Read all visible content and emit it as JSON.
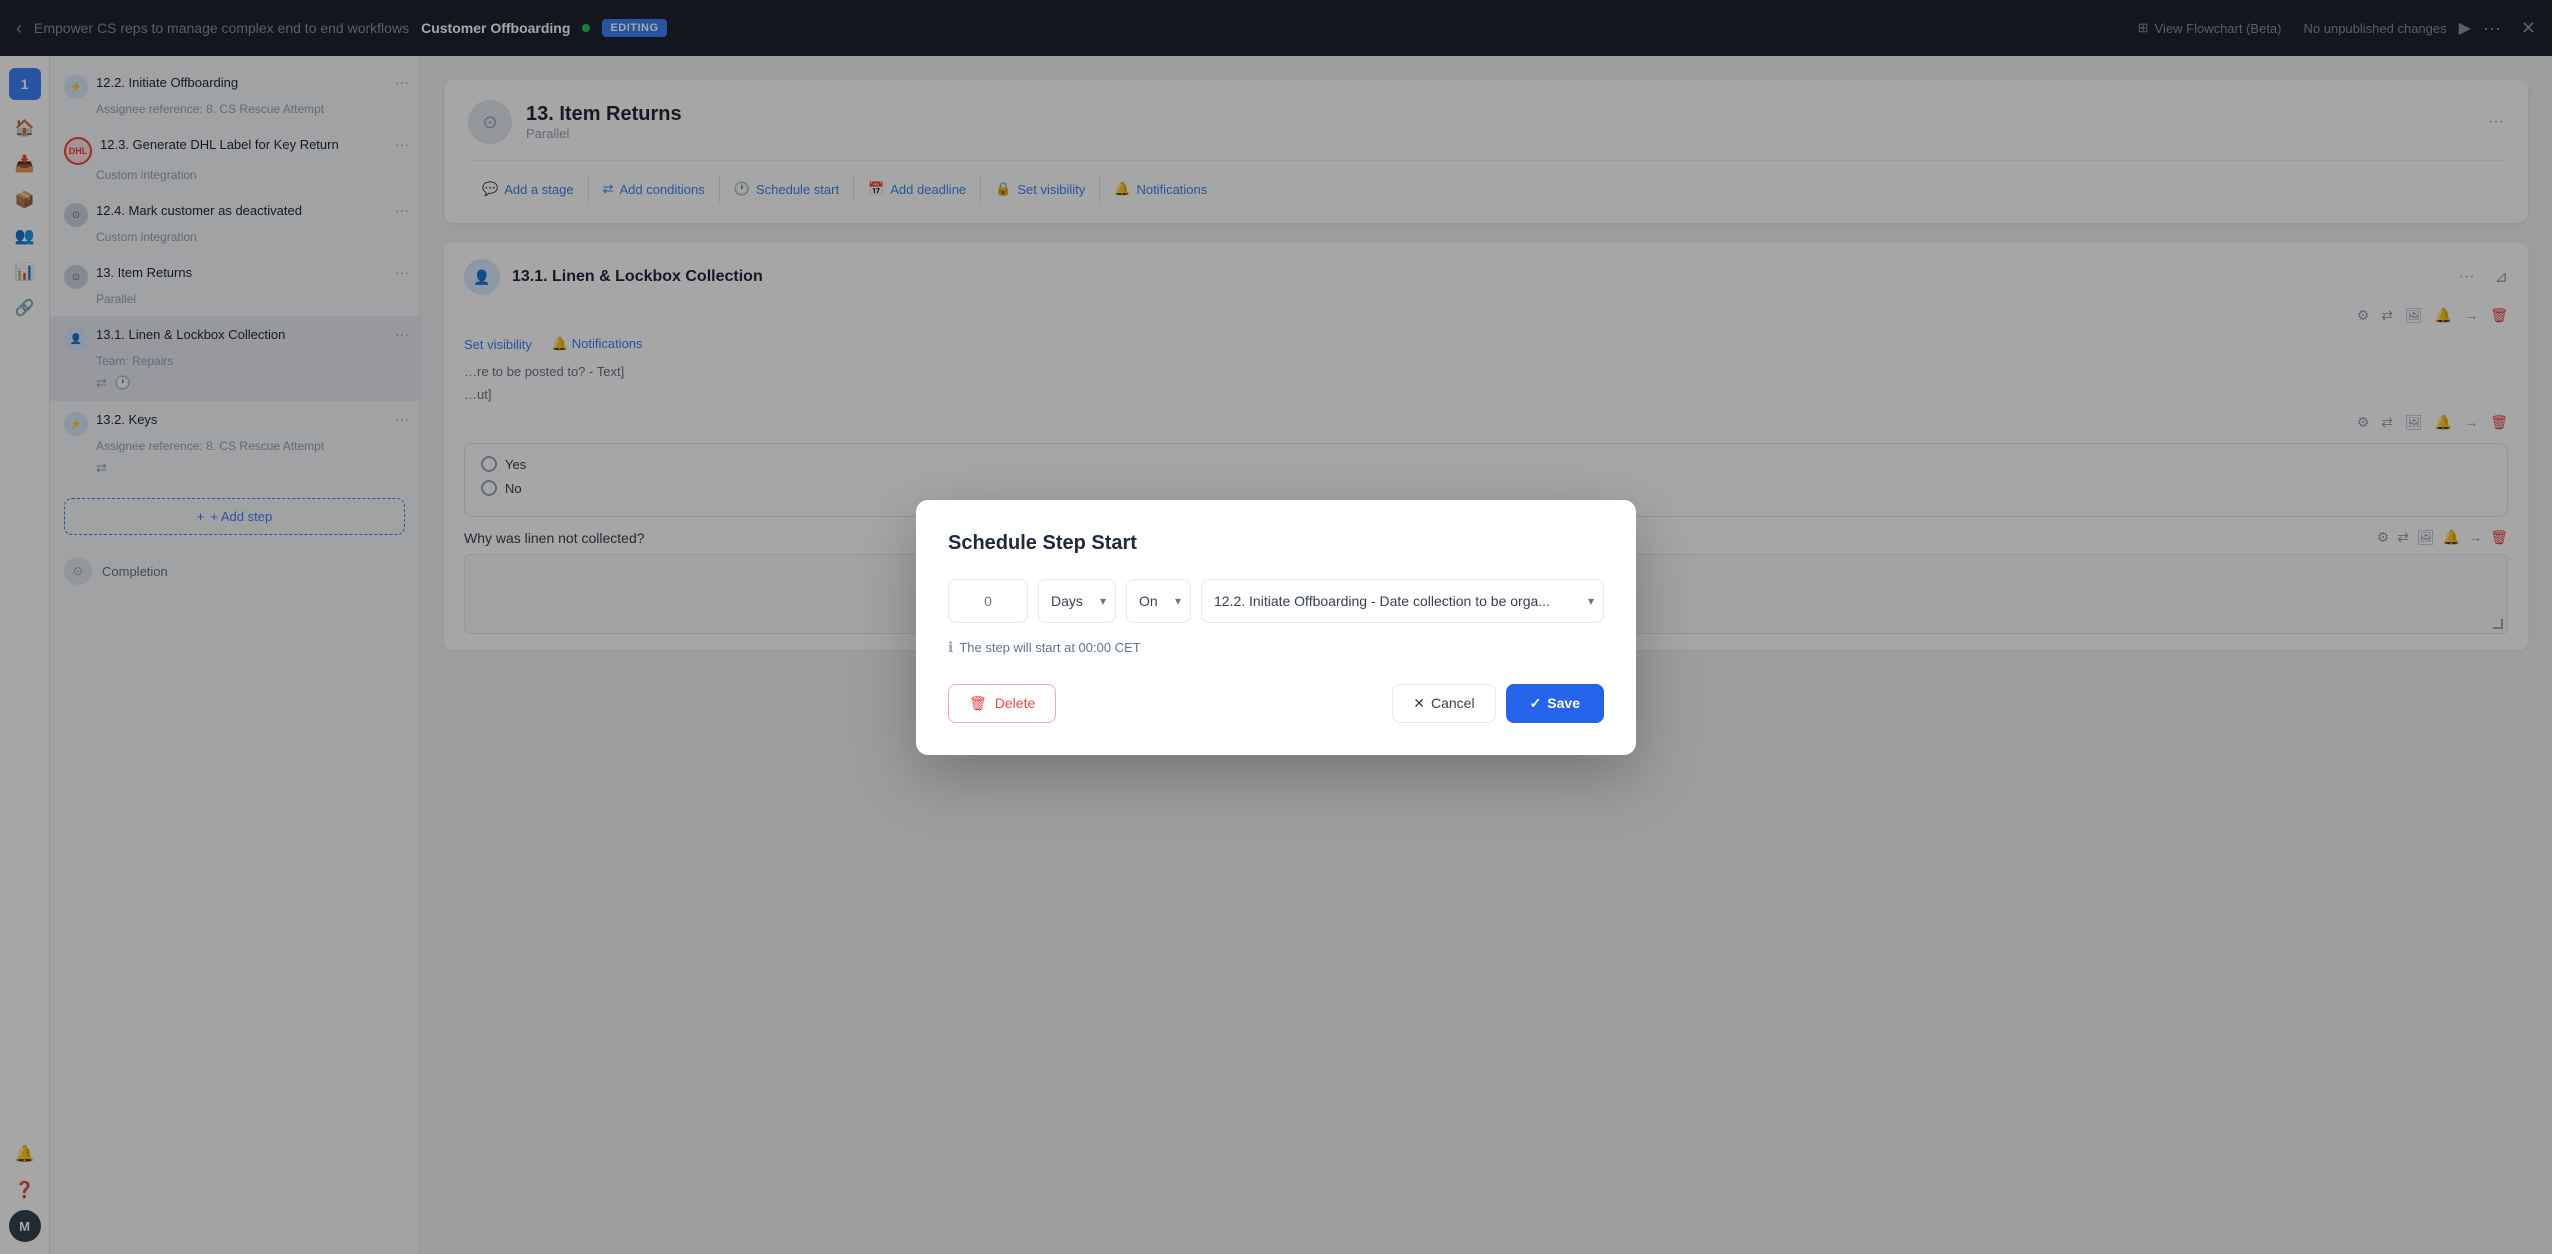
{
  "topbar": {
    "subtitle": "Empower CS reps to manage complex end to end workflows",
    "title": "Customer Offboarding",
    "badge": "EDITING",
    "flowchart_btn": "View Flowchart (Beta)",
    "unpublished": "No unpublished changes",
    "more_label": "···"
  },
  "sidebar": {
    "number": "1",
    "items": [
      {
        "icon": "🏠",
        "label": "home"
      },
      {
        "icon": "📥",
        "label": "inbox"
      },
      {
        "icon": "📦",
        "label": "box"
      },
      {
        "icon": "👥",
        "label": "users"
      },
      {
        "icon": "📊",
        "label": "analytics"
      },
      {
        "icon": "🔗",
        "label": "integrations"
      }
    ],
    "bottom_items": [
      {
        "icon": "🔔",
        "label": "notifications"
      },
      {
        "icon": "❓",
        "label": "help"
      },
      {
        "avatar": "M",
        "label": "user-avatar"
      }
    ]
  },
  "steps": [
    {
      "id": "12.2",
      "name": "12.2. Initiate Offboarding",
      "sub": "Assignee reference: 8. CS Rescue Attempt",
      "icon_type": "blue_circle"
    },
    {
      "id": "12.3",
      "name": "12.3. Generate DHL Label for Key Return",
      "sub": "Custom integration",
      "icon_type": "red_label"
    },
    {
      "id": "12.4",
      "name": "12.4. Mark customer as deactivated",
      "sub": "Custom integration",
      "icon_type": "gray_circle"
    },
    {
      "id": "13",
      "name": "13. Item Returns",
      "sub": "Parallel",
      "icon_type": "gray_circle"
    },
    {
      "id": "13.1",
      "name": "13.1. Linen & Lockbox Collection",
      "sub": "Team: Repairs",
      "icon_type": "person_circle",
      "active": true,
      "has_actions": true
    },
    {
      "id": "13.2",
      "name": "13.2. Keys",
      "sub": "Assignee reference: 8. CS Rescue Attempt",
      "icon_type": "blue_circle",
      "has_share": true
    }
  ],
  "add_step_label": "+ Add step",
  "completion_label": "Completion",
  "stage": {
    "title": "13. Item Returns",
    "type": "Parallel",
    "actions": [
      {
        "label": "Add a stage",
        "icon": "💬"
      },
      {
        "label": "Add conditions",
        "icon": "⇄"
      },
      {
        "label": "Schedule start",
        "icon": "🕐"
      },
      {
        "label": "Add deadline",
        "icon": "📅"
      },
      {
        "label": "Set visibility",
        "icon": "🔒"
      },
      {
        "label": "Notifications",
        "icon": "🔔"
      }
    ],
    "more": "···"
  },
  "step_card": {
    "title": "13.1. Linen & Lockbox Collection",
    "sub_actions": [
      {
        "label": "Set visibility"
      },
      {
        "label": "Notifications"
      }
    ],
    "content_text1": "re to be posted to? - Text]",
    "content_text2": "ut]",
    "question": {
      "label": "Why was linen not collected?",
      "options": [
        "Yes",
        "No"
      ]
    }
  },
  "modal": {
    "title": "Schedule Step Start",
    "input_placeholder": "0",
    "days_options": [
      "Days"
    ],
    "on_options": [
      "On"
    ],
    "on_selected": "On",
    "days_selected": "Days",
    "ref_options": [
      "12.2. Initiate Offboarding - Date collection to be orga..."
    ],
    "ref_selected": "12.2. Initiate Offboarding - Date collection to be orga...",
    "hint": "The step will start at 00:00 CET",
    "delete_label": "Delete",
    "cancel_label": "Cancel",
    "save_label": "Save"
  }
}
